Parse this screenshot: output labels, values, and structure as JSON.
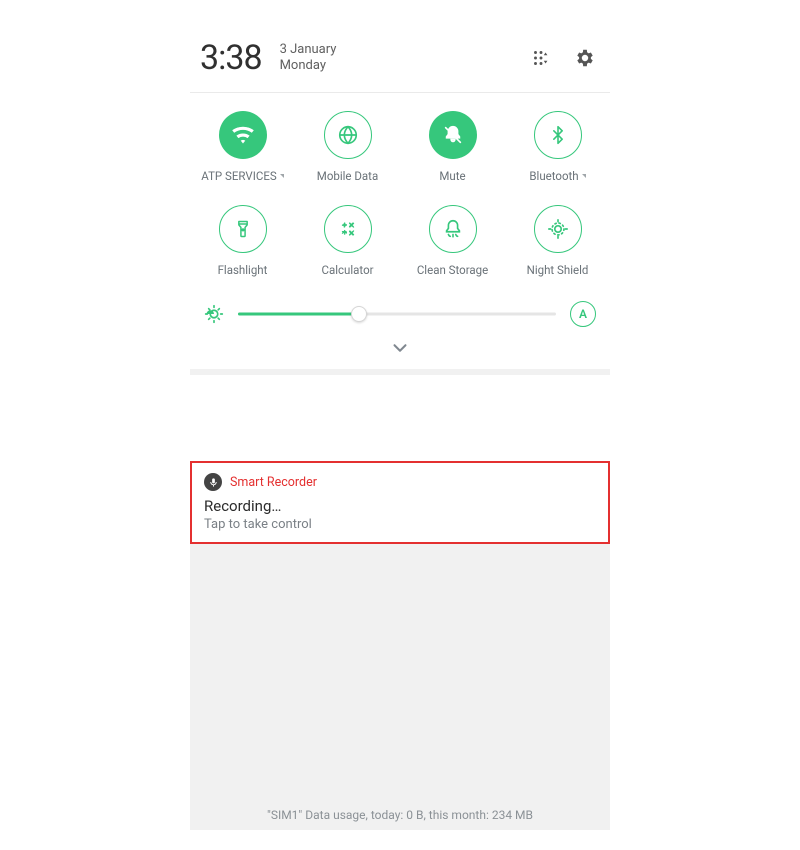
{
  "header": {
    "time": "3:38",
    "date": "3 January",
    "day": "Monday"
  },
  "tiles": [
    {
      "label": "ATP SERVICES",
      "icon": "wifi",
      "active": true,
      "expandable": true
    },
    {
      "label": "Mobile Data",
      "icon": "globe",
      "active": false,
      "expandable": false
    },
    {
      "label": "Mute",
      "icon": "mute",
      "active": true,
      "expandable": false
    },
    {
      "label": "Bluetooth",
      "icon": "bluetooth",
      "active": false,
      "expandable": true
    },
    {
      "label": "Flashlight",
      "icon": "flashlight",
      "active": false,
      "expandable": false
    },
    {
      "label": "Calculator",
      "icon": "calculator",
      "active": false,
      "expandable": false
    },
    {
      "label": "Clean Storage",
      "icon": "clean",
      "active": false,
      "expandable": false
    },
    {
      "label": "Night Shield",
      "icon": "night",
      "active": false,
      "expandable": false
    }
  ],
  "brightness": {
    "value": 38,
    "auto_label": "A"
  },
  "notification": {
    "app": "Smart Recorder",
    "title": "Recording…",
    "subtitle": "Tap to take control"
  },
  "footer": "\"SIM1\" Data usage, today: 0 B, this month: 234 MB",
  "colors": {
    "accent": "#36c77c",
    "highlight": "#e43030"
  }
}
